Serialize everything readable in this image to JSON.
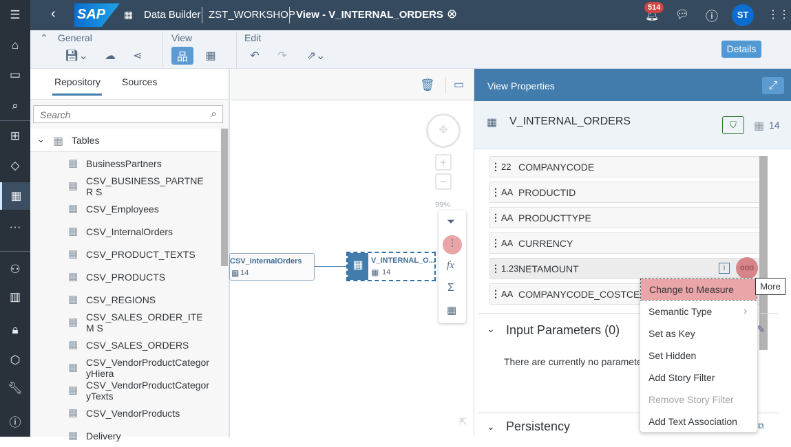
{
  "shell": {
    "app": "Data Builder",
    "space": "ZST_WORKSHOP",
    "document": "View - V_INTERNAL_ORDERS",
    "unsaved_marker": "*",
    "notifications": "514",
    "avatar": "ST",
    "logo": "SAP"
  },
  "toolbar": {
    "general": "General",
    "view": "View",
    "edit": "Edit",
    "details": "Details"
  },
  "left": {
    "tabs": [
      "Repository",
      "Sources"
    ],
    "search_placeholder": "Search",
    "folder": "Tables",
    "items": [
      "BusinessPartners",
      "CSV_BUSINESS_PARTNER S",
      "CSV_Employees",
      "CSV_InternalOrders",
      "CSV_PRODUCT_TEXTS",
      "CSV_PRODUCTS",
      "CSV_REGIONS",
      "CSV_SALES_ORDER_ITEM S",
      "CSV_SALES_ORDERS",
      "CSV_VendorProductCategor yHiera",
      "CSV_VendorProductCategor yTexts",
      "CSV_VendorProducts",
      "Delivery"
    ]
  },
  "canvas": {
    "zoom": "99%",
    "source_node": {
      "name": "CSV_InternalOrders",
      "count": "14"
    },
    "view_node": {
      "name": "V_INTERNAL_O...",
      "count": "14"
    }
  },
  "right": {
    "title": "View Properties",
    "name": "V_INTERNAL_ORDERS",
    "count": "14",
    "columns": [
      {
        "type": "22",
        "name": "COMPANYCODE"
      },
      {
        "type": "AA",
        "name": "PRODUCTID"
      },
      {
        "type": "AA",
        "name": "PRODUCTTYPE"
      },
      {
        "type": "AA",
        "name": "CURRENCY"
      },
      {
        "type": "1.23",
        "name": "NETAMOUNT"
      },
      {
        "type": "AA",
        "name": "COMPANYCODE_COSTCEN"
      }
    ],
    "input_params": "Input Parameters (0)",
    "no_params": "There are currently no paramete",
    "persistency": "Persistency"
  },
  "menu": {
    "items": [
      "Change to Measure",
      "Semantic Type",
      "Set as Key",
      "Set Hidden",
      "Add Story Filter",
      "Remove Story Filter",
      "Add Text Association"
    ],
    "disabled": "Remove Story Filter"
  },
  "tooltip": "More",
  "colors": {
    "shell": "#354a5f",
    "accent": "#427cac",
    "badge": "#d04343",
    "avatar": "#0a6ed1"
  }
}
